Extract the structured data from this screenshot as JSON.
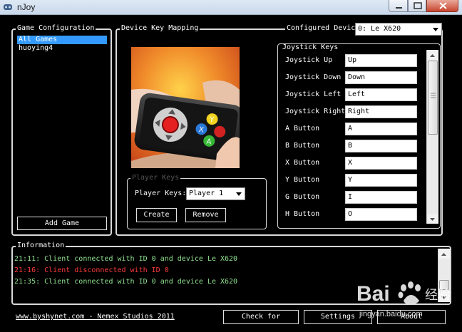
{
  "window": {
    "title": "nJoy",
    "accent": "#3399ff"
  },
  "game_configuration": {
    "label": "Game Configuration",
    "games": [
      "All Games",
      "huoying4"
    ],
    "selected_index": 0,
    "add_game_label": "Add Game"
  },
  "device_key_mapping": {
    "label": "Device Key Mapping",
    "image": "phone-gamepad-illustration",
    "player_keys_group_label": "Player Keys",
    "player_keys_label": "Player Keys:",
    "player_selected": "Player 1",
    "create_label": "Create",
    "remove_label": "Remove"
  },
  "configured_device": {
    "label": "Configured Devic",
    "selected": "0: Le X620"
  },
  "joystick_keys": {
    "label": "Joystick Keys",
    "rows": [
      {
        "label": "Joystick Up",
        "value": "Up"
      },
      {
        "label": "Joystick Down",
        "value": "Down"
      },
      {
        "label": "Joystick Left",
        "value": "Left"
      },
      {
        "label": "Joystick Right",
        "value": "Right"
      },
      {
        "label": "A Button",
        "value": "A"
      },
      {
        "label": "B Button",
        "value": "B"
      },
      {
        "label": "X Button",
        "value": "X"
      },
      {
        "label": "Y Button",
        "value": "Y"
      },
      {
        "label": "G Button",
        "value": "I"
      },
      {
        "label": "H Button",
        "value": "O"
      }
    ]
  },
  "information": {
    "label": "Information",
    "log": [
      {
        "text": "21:11: Client connected with ID 0 and device Le X620",
        "color": "#8fe08f"
      },
      {
        "text": "21:16: Client disconnected with ID 0",
        "color": "#ff3b3b"
      },
      {
        "text": "21:35: Client connected with ID 0 and device Le X620",
        "color": "#8fe08f"
      }
    ]
  },
  "footer": {
    "link": "www.byshynet.com - Nemex Studios 2011",
    "check_label": "Check for",
    "settings_label": "Settings",
    "about_label": "About"
  },
  "watermark": {
    "brand": "Bai",
    "brand2": "经验",
    "url": "jingyan.baidu.com"
  }
}
